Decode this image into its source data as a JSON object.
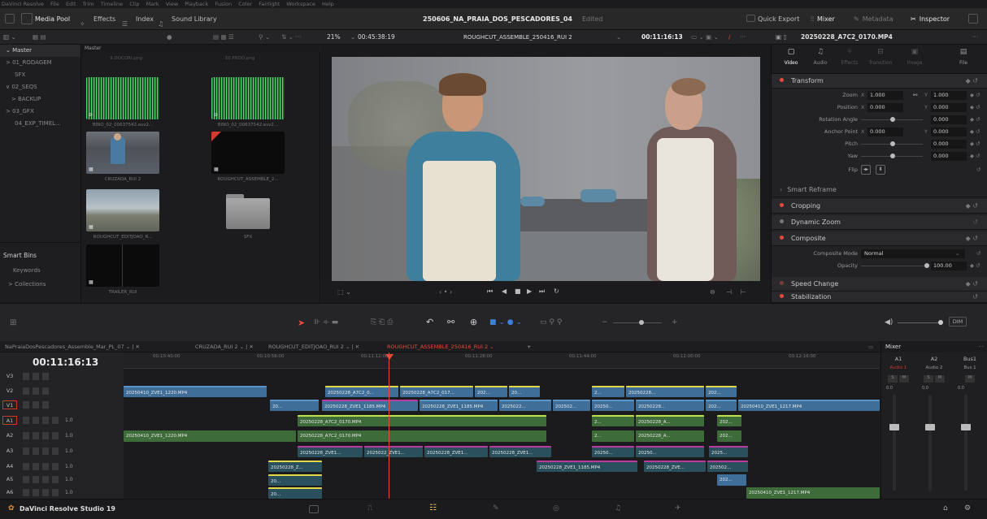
{
  "menubar": {
    "items": [
      "DaVinci Resolve",
      "File",
      "Edit",
      "Trim",
      "Timeline",
      "Clip",
      "Mark",
      "View",
      "Playback",
      "Fusion",
      "Color",
      "Fairlight",
      "Workspace",
      "Help"
    ]
  },
  "toolbar": {
    "media_pool": "Media Pool",
    "effects": "Effects",
    "index": "Index",
    "sound_library": "Sound Library",
    "project_title": "250606_NA_PRAIA_DOS_PESCADORES_04",
    "edited": "Edited",
    "quick_export": "Quick Export",
    "mixer": "Mixer",
    "metadata": "Metadata",
    "inspector": "Inspector"
  },
  "subbar": {
    "zoom": "21%",
    "duration": "00:45:38:19",
    "timeline_name": "ROUGHCUT_ASSEMBLE_250416_RUI 2",
    "timecode": "00:11:16:13",
    "clip_name": "20250228_A7C2_0170.MP4"
  },
  "bins": {
    "master": "Master",
    "items": [
      "> 01_RODAGEM",
      "SFX",
      "∨ 02_SEQS",
      "> BACKUP",
      "> 03_GFX",
      "04_EXP_TIMEL..."
    ],
    "smart_bins": "Smart Bins",
    "smart_items": [
      "Keywords",
      "> Collections"
    ]
  },
  "mediapool": {
    "header": "Master",
    "top_labels": [
      "9.DOCORI.png",
      "10.PROD.png"
    ],
    "clips": [
      "BINO_02_00637542.esv2...",
      "BINO_02_00637542.esv2...",
      "CRUZADA_RUI 2",
      "ROUGHCUT_ASSEMBLE_2...",
      "ROUGHCUT_EDITJOAO_R...",
      "SFX",
      "TRAILER_RUI"
    ]
  },
  "inspector": {
    "tabs": [
      "Video",
      "Audio",
      "Effects",
      "Transition",
      "Image",
      "File"
    ],
    "transform": "Transform",
    "zoom_label": "Zoom",
    "zoom_x": "1.000",
    "zoom_y": "1.000",
    "position_label": "Position",
    "position_x": "0.000",
    "position_y": "0.000",
    "rotation_label": "Rotation Angle",
    "rotation": "0.000",
    "anchor_label": "Anchor Point",
    "anchor_x": "0.000",
    "anchor_y": "0.000",
    "pitch_label": "Pitch",
    "pitch": "0.000",
    "yaw_label": "Yaw",
    "yaw": "0.000",
    "flip_label": "Flip",
    "smart_reframe": "Smart Reframe",
    "cropping": "Cropping",
    "dynamic_zoom": "Dynamic Zoom",
    "composite": "Composite",
    "composite_mode_label": "Composite Mode",
    "composite_mode": "Normal",
    "opacity_label": "Opacity",
    "opacity": "100.00",
    "speed_change": "Speed Change",
    "stabilization": "Stabilization"
  },
  "timeline": {
    "tabs": [
      "NaPraiaDosPescadores_Assemble_Mar_PL_07",
      "CRUZADA_RUI 2",
      "ROUGHCUT_EDITJOAO_RUI 2",
      "ROUGHCUT_ASSEMBLE_250416_RUI 2"
    ],
    "timecode": "00:11:16:13",
    "ruler": [
      "00:10:40:00",
      "00:10:56:00",
      "00:11:12:00",
      "00:11:28:00",
      "00:11:44:00",
      "00:12:00:00",
      "00:12:16:00"
    ],
    "tracks": [
      "V3",
      "V2",
      "V1",
      "A1",
      "A2",
      "A3",
      "A4",
      "A5",
      "A6"
    ],
    "track_level": "1.0",
    "clips": {
      "v2_a": "20250410_ZVE1_1220.MP4",
      "v2_b": "20250228_A7C2_0...",
      "v2_c": "20250228_A7C2_017...",
      "v2_d": "202...",
      "v2_e": "20...",
      "v2_f": "2...",
      "v2_g": "20250228...",
      "v2_h": "202...",
      "v1_a": "20...",
      "v1_b": "20250228_ZVE1_1185.MP4",
      "v1_c": "20250228_ZVE1_1185.MP4",
      "v1_d": "2025022...",
      "v1_e": "202502...",
      "v1_f": "20250...",
      "v1_g": "20250228...",
      "v1_h": "202...",
      "v1_i": "20250410_ZVE1_1217.MP4",
      "a1_a": "20250228_A7C2_0170.MP4",
      "a1_b": "2...",
      "a1_c": "20250228_A...",
      "a1_d": "202...",
      "a2_a": "20250410_ZVE1_1220.MP4",
      "a2_b": "20250228_A7C2_0170.MP4",
      "a2_c": "2...",
      "a2_d": "20250228_A...",
      "a2_e": "202...",
      "a3_a": "20250228_ZVE1...",
      "a3_b": "2025022_ZVE1...",
      "a3_c": "20250228_ZVE1...",
      "a3_d": "20250228_ZVE1...",
      "a3_e": "20250...",
      "a3_f": "20250...",
      "a3_g": "2025...",
      "a4_a": "20250228_Z...",
      "a4_b": "20250228_ZVE1_1185.MP4",
      "a4_c": "20250228_ZVE...",
      "a4_d": "202502...",
      "a5_a": "20...",
      "a5_b": "202...",
      "a6_a": "20...",
      "a6_b": "20250410_ZVE1_1217.MP4"
    }
  },
  "mixer": {
    "title": "Mixer",
    "channels": [
      "A1",
      "A2",
      "Bus1"
    ],
    "sub": [
      "Audio 1",
      "Audio 2",
      "Bus 1"
    ],
    "levels": [
      "0.0",
      "0.0",
      "0.0"
    ],
    "dim": "DIM"
  },
  "status": {
    "app": "DaVinci Resolve Studio 19"
  },
  "colors": {
    "accent": "#e64b3c",
    "playhead": "#e64b3c",
    "video_clip": "#3f6e98",
    "audio_clip": "#3e6b3a",
    "pink_clip": "#7d3f8f"
  }
}
